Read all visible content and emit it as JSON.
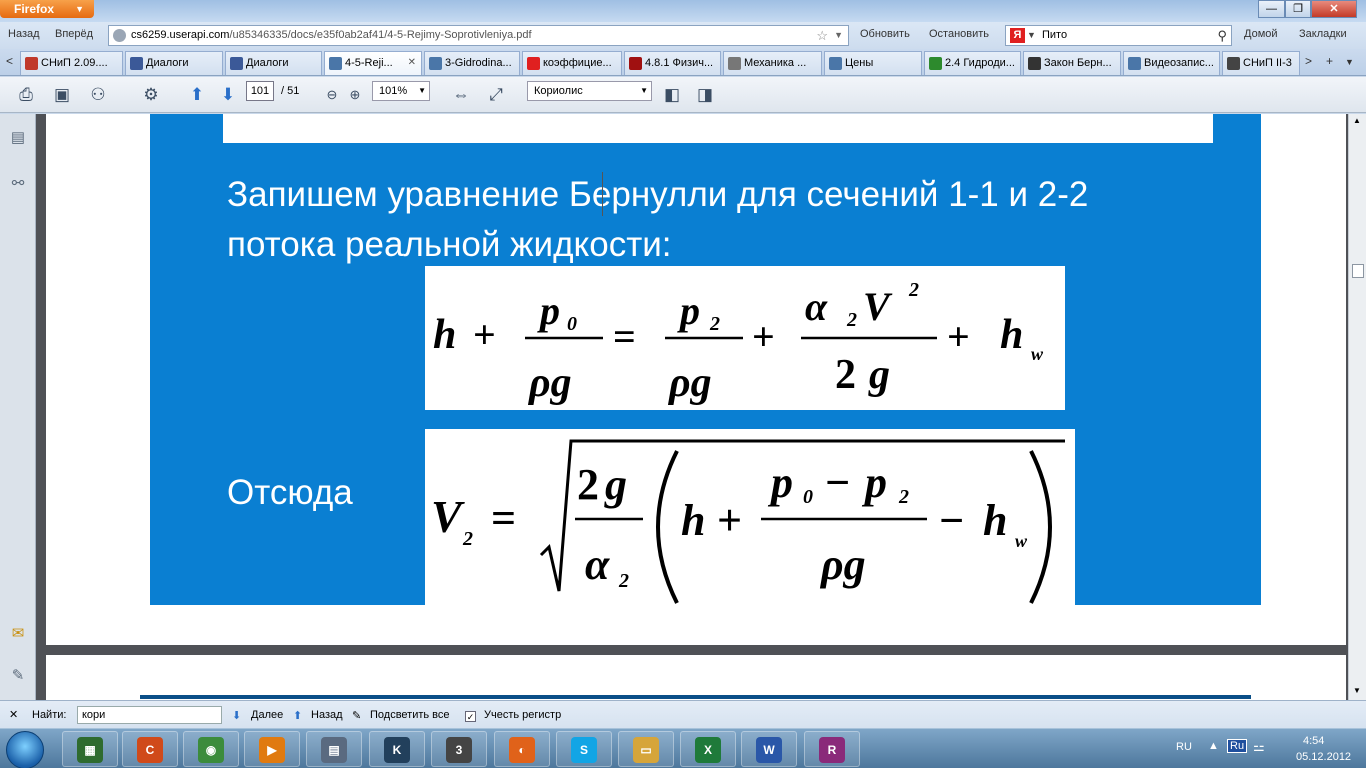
{
  "browser": {
    "app_button": "Firefox",
    "nav": {
      "back": "Назад",
      "forward": "Вперёд"
    },
    "url": {
      "host": "cs6259.userapi.com",
      "path": "/u85346335/docs/e35f0ab2af41/4-5-Rejimy-Soprotivleniya.pdf"
    },
    "reload": "Обновить",
    "stop": "Остановить",
    "search": {
      "value": "Пито"
    },
    "home": "Домой",
    "bookmarks": "Закладки"
  },
  "tabs": [
    {
      "label": "СНиП 2.09....",
      "icon_color": "#c0392b",
      "icon": "doc-icon"
    },
    {
      "label": "Диалоги",
      "icon_color": "#3b5998",
      "icon": "vk-icon"
    },
    {
      "label": "Диалоги",
      "icon_color": "#3b5998",
      "icon": "vk-icon"
    },
    {
      "label": "4-5-Reji...",
      "icon_color": "#4a76a8",
      "icon": "vk-icon",
      "active": true
    },
    {
      "label": "3-Gidrodina...",
      "icon_color": "#4a76a8",
      "icon": "vk-icon"
    },
    {
      "label": "коэффицие...",
      "icon_color": "#e02020",
      "icon": "yandex-icon"
    },
    {
      "label": "4.8.1 Физич...",
      "icon_color": "#a01010",
      "icon": "pdf-icon"
    },
    {
      "label": "Механика ...",
      "icon_color": "#777777",
      "icon": "folder-icon"
    },
    {
      "label": "Цены",
      "icon_color": "#4a76a8",
      "icon": "vk-icon"
    },
    {
      "label": "2.4 Гидроди...",
      "icon_color": "#2d8a2d",
      "icon": "site-icon"
    },
    {
      "label": "Закон Берн...",
      "icon_color": "#333333",
      "icon": "wikipedia-icon"
    },
    {
      "label": "Видеозапис...",
      "icon_color": "#4a76a8",
      "icon": "vk-icon"
    },
    {
      "label": "СНиП II-3",
      "icon_color": "#444444",
      "icon": "doc-icon"
    }
  ],
  "pdf_toolbar": {
    "page_current": "101",
    "page_total": "/ 51",
    "zoom": "101%",
    "find_combo": "Кориолис"
  },
  "slide": {
    "sentence_line1": "Запишем уравнение Бернулли для сечений 1-1 и 2-2",
    "sentence_line2": "потока реальной жидкости:",
    "hence_label": "Отсюда"
  },
  "findbar": {
    "label": "Найти:",
    "query": "кори",
    "next": "Далее",
    "prev": "Назад",
    "highlight_all": "Подсветить все",
    "match_case": "Учесть регистр"
  },
  "taskbar": {
    "lang": "RU",
    "lang_badge": "Ru",
    "time": "4:54",
    "date": "05.12.2012",
    "apps": [
      {
        "name": "task-manager",
        "color": "#2f6b2f",
        "glyph": "▦"
      },
      {
        "name": "ccleaner",
        "color": "#d04a1a",
        "glyph": "C"
      },
      {
        "name": "chrome",
        "color": "#3c8c3c",
        "glyph": "◉"
      },
      {
        "name": "media-player",
        "color": "#e07a10",
        "glyph": "▶"
      },
      {
        "name": "calculator",
        "color": "#5a6a80",
        "glyph": "▤"
      },
      {
        "name": "kmplayer",
        "color": "#22405c",
        "glyph": "K"
      },
      {
        "name": "media-classic",
        "color": "#444444",
        "glyph": "3"
      },
      {
        "name": "firefox",
        "color": "#e0621a",
        "glyph": "◐"
      },
      {
        "name": "skype",
        "color": "#12a5e5",
        "glyph": "S"
      },
      {
        "name": "explorer",
        "color": "#d6a53a",
        "glyph": "▭"
      },
      {
        "name": "excel",
        "color": "#1f7a3a",
        "glyph": "X"
      },
      {
        "name": "word",
        "color": "#2a57a8",
        "glyph": "W"
      },
      {
        "name": "winrar",
        "color": "#8a2a7a",
        "glyph": "R"
      }
    ]
  }
}
